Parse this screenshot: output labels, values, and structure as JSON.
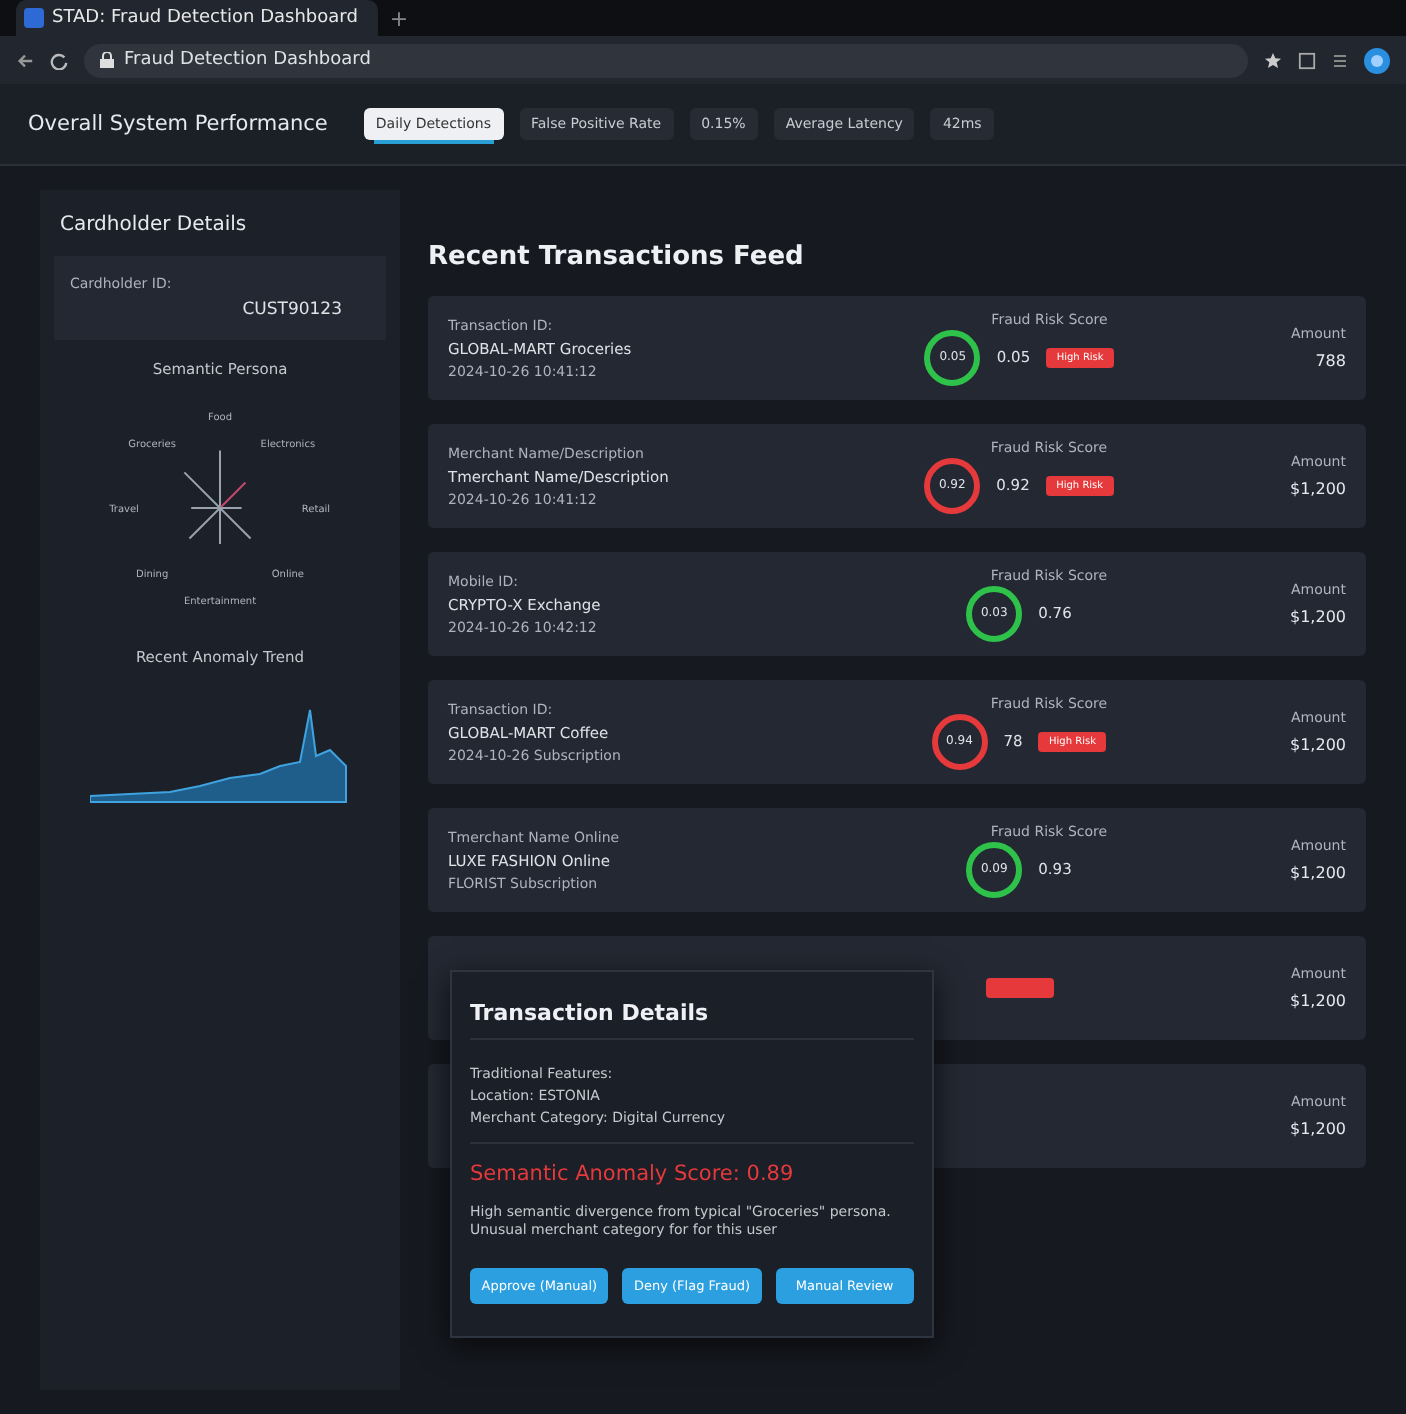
{
  "browser": {
    "tab_title": "STAD: Fraud Detection Dashboard",
    "new_tab": "+",
    "address": "Fraud Detection Dashboard"
  },
  "performance": {
    "title": "Overall System Performance",
    "pills": [
      {
        "label": "Daily Detections",
        "selected": true
      },
      {
        "label": "False Positive Rate",
        "selected": false
      },
      {
        "label": "0.15%",
        "selected": false
      },
      {
        "label": "Average Latency",
        "selected": false
      },
      {
        "label": "42ms",
        "selected": false
      }
    ]
  },
  "sidebar": {
    "title": "Cardholder Details",
    "id_label": "Cardholder ID:",
    "id_value": "CUST90123",
    "persona_title": "Semantic Persona",
    "persona_axes": [
      "Food",
      "Electronics",
      "Retail",
      "Online",
      "Entertainment",
      "Dining",
      "Travel",
      "Groceries"
    ],
    "trend_title": "Recent Anomaly Trend"
  },
  "feed": {
    "title": "Recent Transactions Feed",
    "rows": [
      {
        "label": "Transaction ID:",
        "merchant": "GLOBAL-MART Groceries",
        "detail": "2024-10-26 10:41:12",
        "score_label": "Fraud Risk Score",
        "gauge": "0.05",
        "score": "0.05",
        "color": "#2fc24a",
        "flagged": true,
        "badge": "High Risk",
        "amount_label": "Amount",
        "amount": "788"
      },
      {
        "label": "Merchant Name/Description",
        "merchant": "Tmerchant Name/Description",
        "detail": "2024-10-26 10:41:12",
        "score_label": "Fraud Risk Score",
        "gauge": "0.92",
        "score": "0.92",
        "color": "#e5393b",
        "flagged": true,
        "badge": "High Risk",
        "amount_label": "Amount",
        "amount": "$1,200"
      },
      {
        "label": "Mobile ID:",
        "merchant": "CRYPTO-X Exchange",
        "detail": "2024-10-26 10:42:12",
        "score_label": "Fraud Risk Score",
        "gauge": "0.03",
        "score": "0.76",
        "color": "#2fc24a",
        "flagged": false,
        "amount_label": "Amount",
        "amount": "$1,200"
      },
      {
        "label": "Transaction ID:",
        "merchant": "GLOBAL-MART Coffee",
        "detail": "2024-10-26 Subscription",
        "score_label": "Fraud Risk Score",
        "gauge": "0.94",
        "score": "78",
        "color": "#e5393b",
        "flagged": true,
        "badge": "High Risk",
        "amount_label": "Amount",
        "amount": "$1,200"
      },
      {
        "label": "Tmerchant Name Online",
        "merchant": "LUXE FASHION Online",
        "detail": "FLORIST Subscription",
        "score_label": "Fraud Risk Score",
        "gauge": "0.09",
        "score": "0.93",
        "color": "#2fc24a",
        "flagged": false,
        "amount_label": "Amount",
        "amount": "$1,200"
      },
      {
        "flagged": true,
        "amount_label": "Amount",
        "amount": "$1,200"
      },
      {
        "flagged": false,
        "amount_label": "Amount",
        "amount": "$1,200"
      }
    ]
  },
  "details": {
    "title": "Transaction Details",
    "features": [
      "Traditional Features:",
      "Location: ESTONIA",
      "Merchant Category: Digital Currency"
    ],
    "anomaly_score": "Semantic Anomaly Score: 0.89",
    "explanation": "High semantic divergence from typical \"Groceries\" persona. Unusual merchant category for for this user",
    "buttons": [
      "Approve (Manual)",
      "Deny (Flag Fraud)",
      "Manual Review"
    ]
  }
}
